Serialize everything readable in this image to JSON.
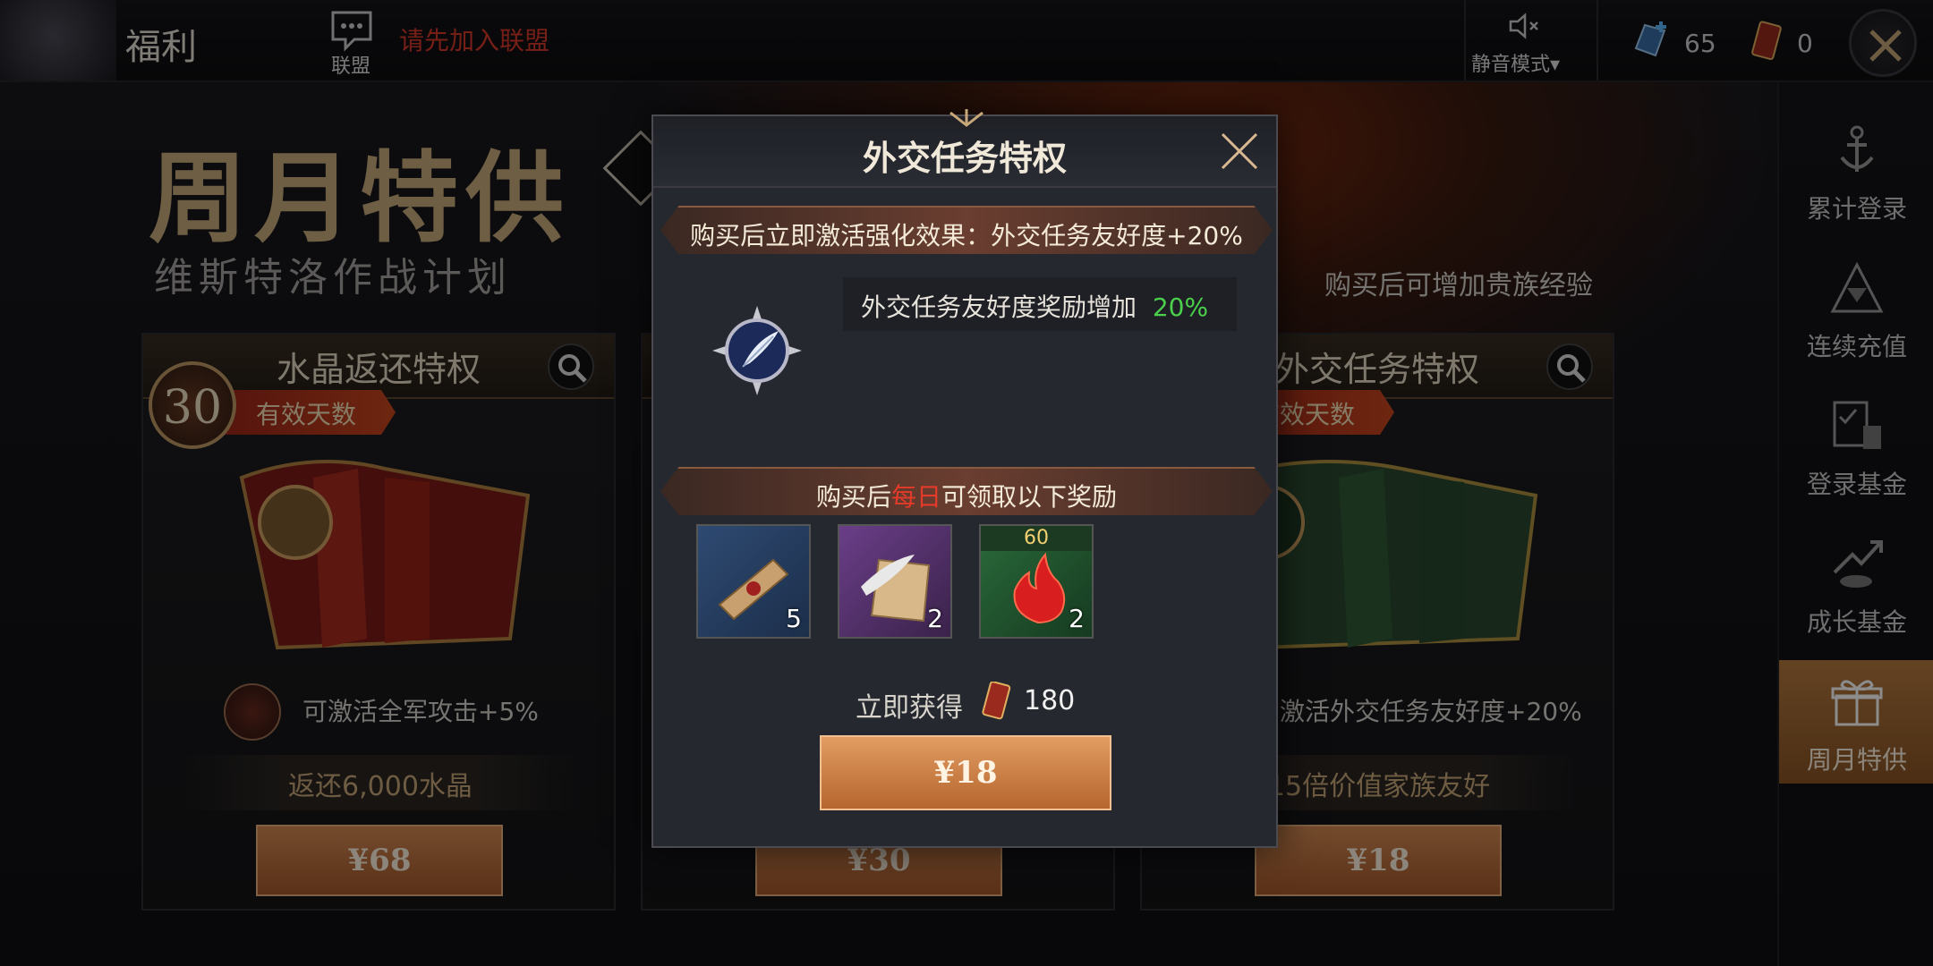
{
  "header": {
    "page_title": "福利",
    "alliance_label": "联盟",
    "alliance_notice": "请先加入联盟",
    "mute_label": "静音模式",
    "mute_arrow": "▾",
    "crystals": "65",
    "tickets": "0"
  },
  "banner": {
    "title": "周月特供",
    "subtitle": "维斯特洛作战计划",
    "right_note": "购买后可增加贵族经验"
  },
  "cards": [
    {
      "title": "水晶返还特权",
      "days": "30",
      "days_label": "有效天数",
      "buff": "可激活全军攻击+5%",
      "refund": "返还6,000水晶",
      "price": "¥68"
    },
    {
      "price": "¥30"
    },
    {
      "title": "外交任务特权",
      "days_label": "有效天数",
      "buff": "激活外交任务友好度+20%",
      "refund": "15倍价值家族友好",
      "price": "¥18"
    }
  ],
  "sidebar": {
    "items": [
      {
        "label": "累计登录"
      },
      {
        "label": "连续充值"
      },
      {
        "label": "登录基金"
      },
      {
        "label": "成长基金"
      },
      {
        "label": "周月特供"
      }
    ]
  },
  "modal": {
    "title": "外交任务特权",
    "effect_banner": "购买后立即激活强化效果：外交任务友好度+20%",
    "effect_text": "外交任务友好度奖励增加",
    "effect_value": "20%",
    "daily_banner_pre": "购买后",
    "daily_banner_highlight": "每日",
    "daily_banner_post": "可领取以下奖励",
    "rewards": [
      {
        "icon": "scroll-icon",
        "count": "5"
      },
      {
        "icon": "quill-letter-icon",
        "count": "2"
      },
      {
        "icon": "red-flame-icon",
        "count": "2",
        "tag": "60"
      }
    ],
    "instant_label": "立即获得",
    "instant_value": "180",
    "buy_price": "¥18"
  },
  "colors": {
    "accent_orange": "#c8763c",
    "highlight_red": "#e43a2a",
    "effect_green": "#4cd04c"
  }
}
